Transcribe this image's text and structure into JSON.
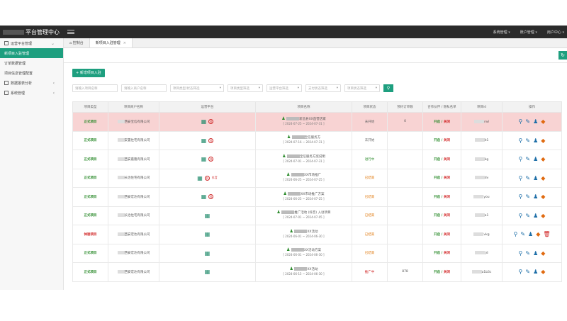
{
  "app": {
    "title": "平台管理中心"
  },
  "topbar": {
    "menu1": "系统管理",
    "menu2": "账户管理",
    "menu3": "用户中心"
  },
  "sidebar": {
    "items": [
      {
        "label": "运营平台管理",
        "type": "group"
      },
      {
        "label": "新项目入驻管理",
        "type": "active"
      },
      {
        "label": "订单数据管理",
        "type": "item"
      },
      {
        "label": "项目信息管理配置",
        "type": "item"
      },
      {
        "label": "数据报表分析",
        "type": "group"
      },
      {
        "label": "系统管理",
        "type": "group"
      }
    ]
  },
  "tabs": [
    {
      "label": "控制台",
      "icon": "home-icon"
    },
    {
      "label": "新项目入驻管理",
      "active": true
    }
  ],
  "toolbar": {
    "add_label": "+ 新增项目入驻",
    "refresh_icon": "refresh-icon"
  },
  "filters": {
    "f1": "请输入项目名称",
    "f2": "请输入商户名称",
    "f3": "项目类型/状态筛选",
    "f4": "项目类型筛选",
    "f5": "运营平台筛选",
    "f6": "支付状态筛选",
    "f7": "项目状态筛选"
  },
  "table": {
    "headers": [
      "项目类型",
      "项目商户名称",
      "运营平台",
      "项目名称",
      "项目状态",
      "预约订单数",
      "合作伙伴 / 隐私名单",
      "项目id",
      "操作"
    ],
    "rows": [
      {
        "type": "正式项目",
        "merchant": "西安宝信有限公司",
        "plat_tk": true,
        "plat_label": "",
        "name": "新昌县XX直营店家",
        "date": "[ 2024-07-25 ~ 2024-07-31 ]",
        "status": "未开始",
        "status_class": "st-gray",
        "orders": "0",
        "on": "开启",
        "off": "关闭",
        "pid": "rwl",
        "del": false,
        "hl": true
      },
      {
        "type": "正式项目",
        "merchant": "安置住宅有限公司",
        "plat_tk": true,
        "plat_label": "",
        "name": "宝信服务方",
        "date": "[ 2024-07-16 ~ 2024-07-31 ]",
        "status": "未开始",
        "status_class": "st-gray",
        "orders": "",
        "on": "开启",
        "off": "关闭",
        "pid": "it1",
        "del": false,
        "hl": false
      },
      {
        "type": "正式项目",
        "merchant": "西安嘉隆有限公司",
        "plat_tk": true,
        "plat_label": "",
        "name": "宝信服务方案说明",
        "date": "[ 2024-07-01 ~ 2024-07-31 ]",
        "status": "进行中",
        "status_class": "st-green",
        "orders": "",
        "on": "开启",
        "off": "关闭",
        "pid": "kg",
        "del": false,
        "hl": false
      },
      {
        "type": "正式项目",
        "merchant": "长治住宅有限公司",
        "plat_tk": true,
        "plat_label": "抖音",
        "name": "XX市场推广",
        "date": "[ 2024-06-25 ~ 2024-07-25 ]",
        "status": "已结束",
        "status_class": "st-orange",
        "orders": "",
        "on": "开启",
        "off": "关闭",
        "pid": "dv",
        "del": false,
        "hl": false
      },
      {
        "type": "正式项目",
        "merchant": "西安宏达有限公司",
        "plat_tk": true,
        "plat_label": "",
        "name": "XX市场推广方案",
        "date": "[ 2024-06-25 ~ 2024-07-25 ]",
        "status": "已结束",
        "status_class": "st-orange",
        "orders": "",
        "on": "开启",
        "off": "关闭",
        "pid": "you",
        "del": false,
        "hl": false
      },
      {
        "type": "正式项目",
        "merchant": "长治住宅有限公司",
        "plat_tk": false,
        "plat_label": "",
        "name": "推广活动 (抖音) 入驻项目",
        "date": "[ 2024-07-01 ~ 2024-07-05 ]",
        "status": "已结束",
        "status_class": "st-orange",
        "orders": "",
        "on": "开启",
        "off": "关闭",
        "pid": "a1",
        "del": false,
        "hl": false
      },
      {
        "type": "体验项目",
        "merchant": "西安宏达有限公司",
        "plat_tk": false,
        "plat_label": "",
        "name": "XX活动",
        "date": "[ 2024-06-01 ~ 2024-06-30 ]",
        "status": "已结束",
        "status_class": "st-orange",
        "orders": "",
        "on": "开启",
        "off": "关闭",
        "pid": "vkg",
        "del": true,
        "hl": false
      },
      {
        "type": "正式项目",
        "merchant": "西安宏达有限公司",
        "plat_tk": false,
        "plat_label": "",
        "name": "XX活动方案",
        "date": "[ 2024-06-01 ~ 2024-06-30 ]",
        "status": "已结束",
        "status_class": "st-orange",
        "orders": "",
        "on": "开启",
        "off": "关闭",
        "pid": "jd",
        "del": false,
        "hl": false
      },
      {
        "type": "正式项目",
        "merchant": "西安宏达有限公司",
        "plat_tk": false,
        "plat_label": "",
        "name": "XX活动",
        "date": "[ 2024-06-15 ~ 2024-06-30 ]",
        "status": "推广中",
        "status_class": "st-red",
        "orders": "878",
        "on": "开启",
        "off": "关闭",
        "pid": "a1b3c",
        "del": false,
        "hl": false
      }
    ]
  }
}
